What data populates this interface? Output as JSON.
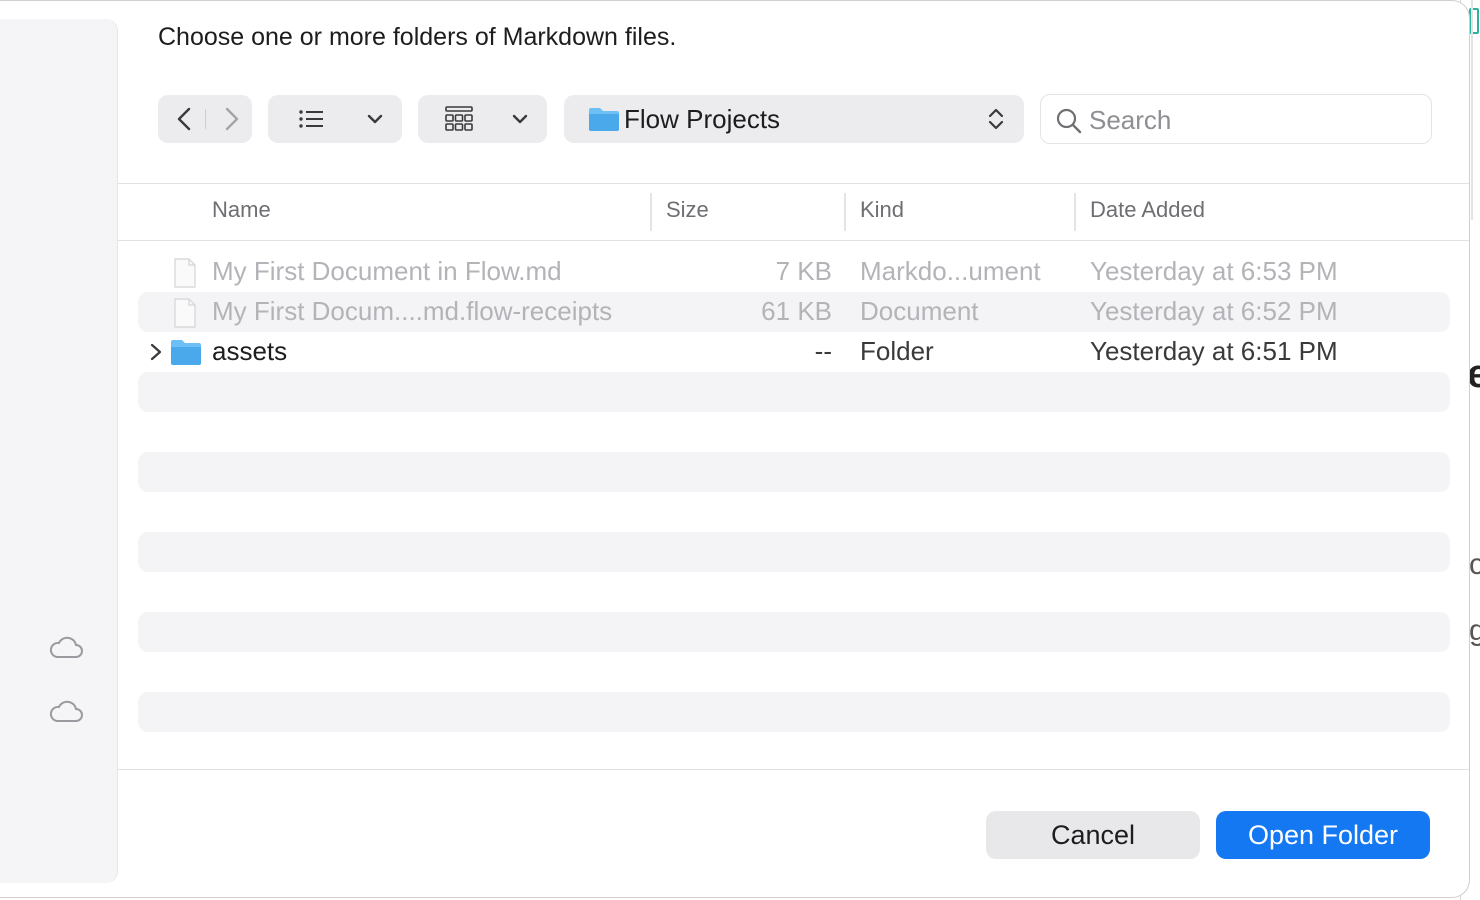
{
  "dialog": {
    "prompt": "Choose one or more folders of Markdown files."
  },
  "toolbar": {
    "nav_back_icon": "chevron-left-icon",
    "nav_forward_icon": "chevron-right-icon",
    "view_list_icon": "list-icon",
    "view_grid_icon": "grid-icon",
    "location": "Flow Projects"
  },
  "search": {
    "placeholder": "Search"
  },
  "columns": {
    "name": "Name",
    "size": "Size",
    "kind": "Kind",
    "date": "Date Added"
  },
  "files": [
    {
      "name": "My First Document in Flow.md",
      "size": "7 KB",
      "kind": "Markdo...ument",
      "date": "Yesterday at 6:53 PM",
      "enabled": false,
      "type": "document"
    },
    {
      "name": "My First Docum....md.flow-receipts",
      "size": "61 KB",
      "kind": "Document",
      "date": "Yesterday at 6:52 PM",
      "enabled": false,
      "type": "document"
    },
    {
      "name": "assets",
      "size": "--",
      "kind": "Folder",
      "date": "Yesterday at 6:51 PM",
      "enabled": true,
      "type": "folder"
    }
  ],
  "buttons": {
    "cancel": "Cancel",
    "open": "Open Folder"
  },
  "colors": {
    "accent": "#1478f2",
    "folder": "#5ab4f0"
  }
}
